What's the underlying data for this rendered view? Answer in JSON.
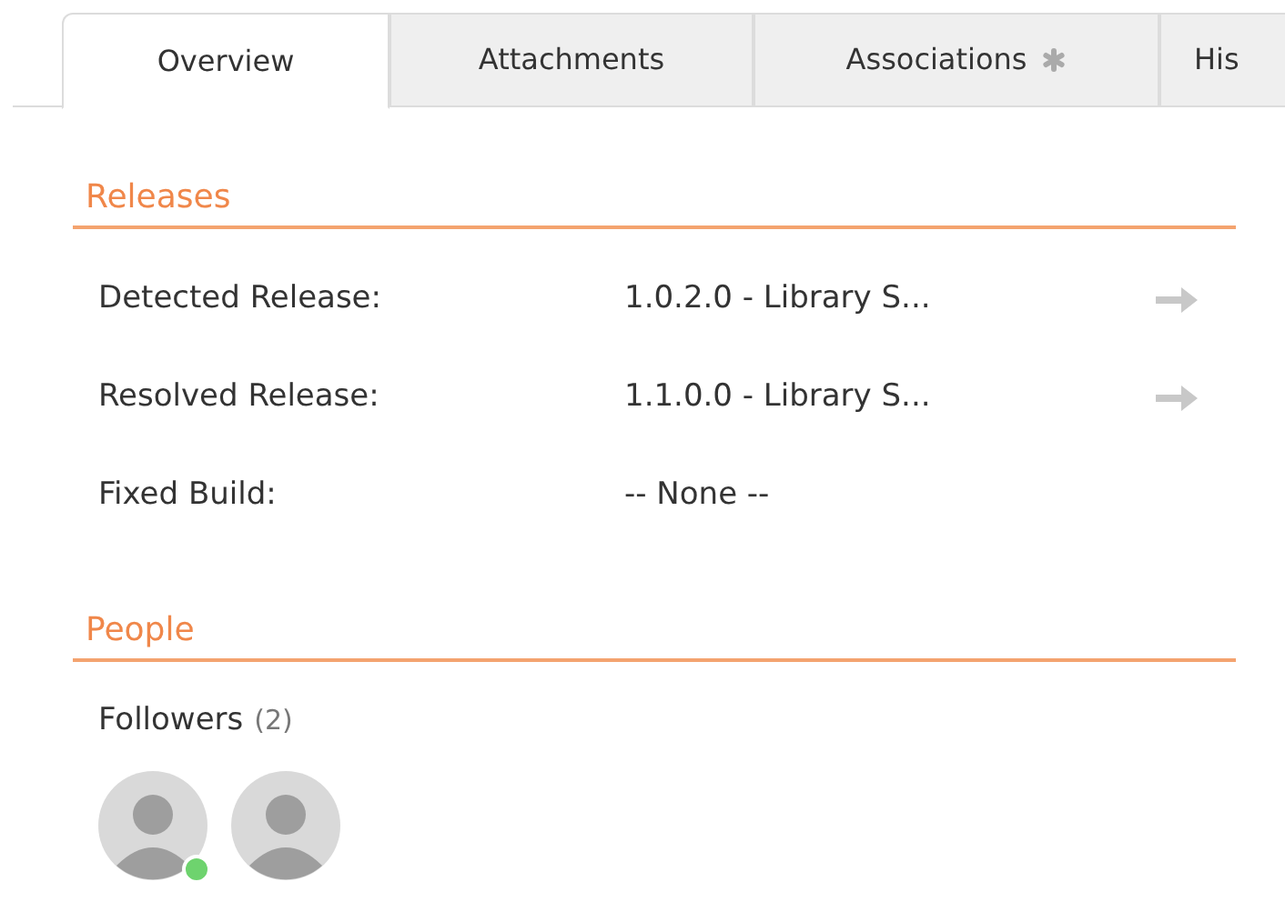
{
  "tabs": [
    {
      "label": "Overview",
      "selected": true,
      "flagged": false
    },
    {
      "label": "Attachments",
      "selected": false,
      "flagged": false
    },
    {
      "label": "Associations",
      "selected": false,
      "flagged": true
    },
    {
      "label": "His",
      "selected": false,
      "flagged": false
    }
  ],
  "sections": [
    {
      "title": "Releases",
      "fields": [
        {
          "label": "Detected Release:",
          "value": "1.0.2.0 - Library S...",
          "link": true
        },
        {
          "label": "Resolved Release:",
          "value": "1.1.0.0 - Library S...",
          "link": true
        },
        {
          "label": "Fixed Build:",
          "value": "-- None --",
          "link": false
        }
      ]
    },
    {
      "title": "People",
      "followers": {
        "label": "Followers",
        "count": "(2)",
        "people": [
          {
            "online": true
          },
          {
            "online": false
          }
        ]
      }
    }
  ]
}
